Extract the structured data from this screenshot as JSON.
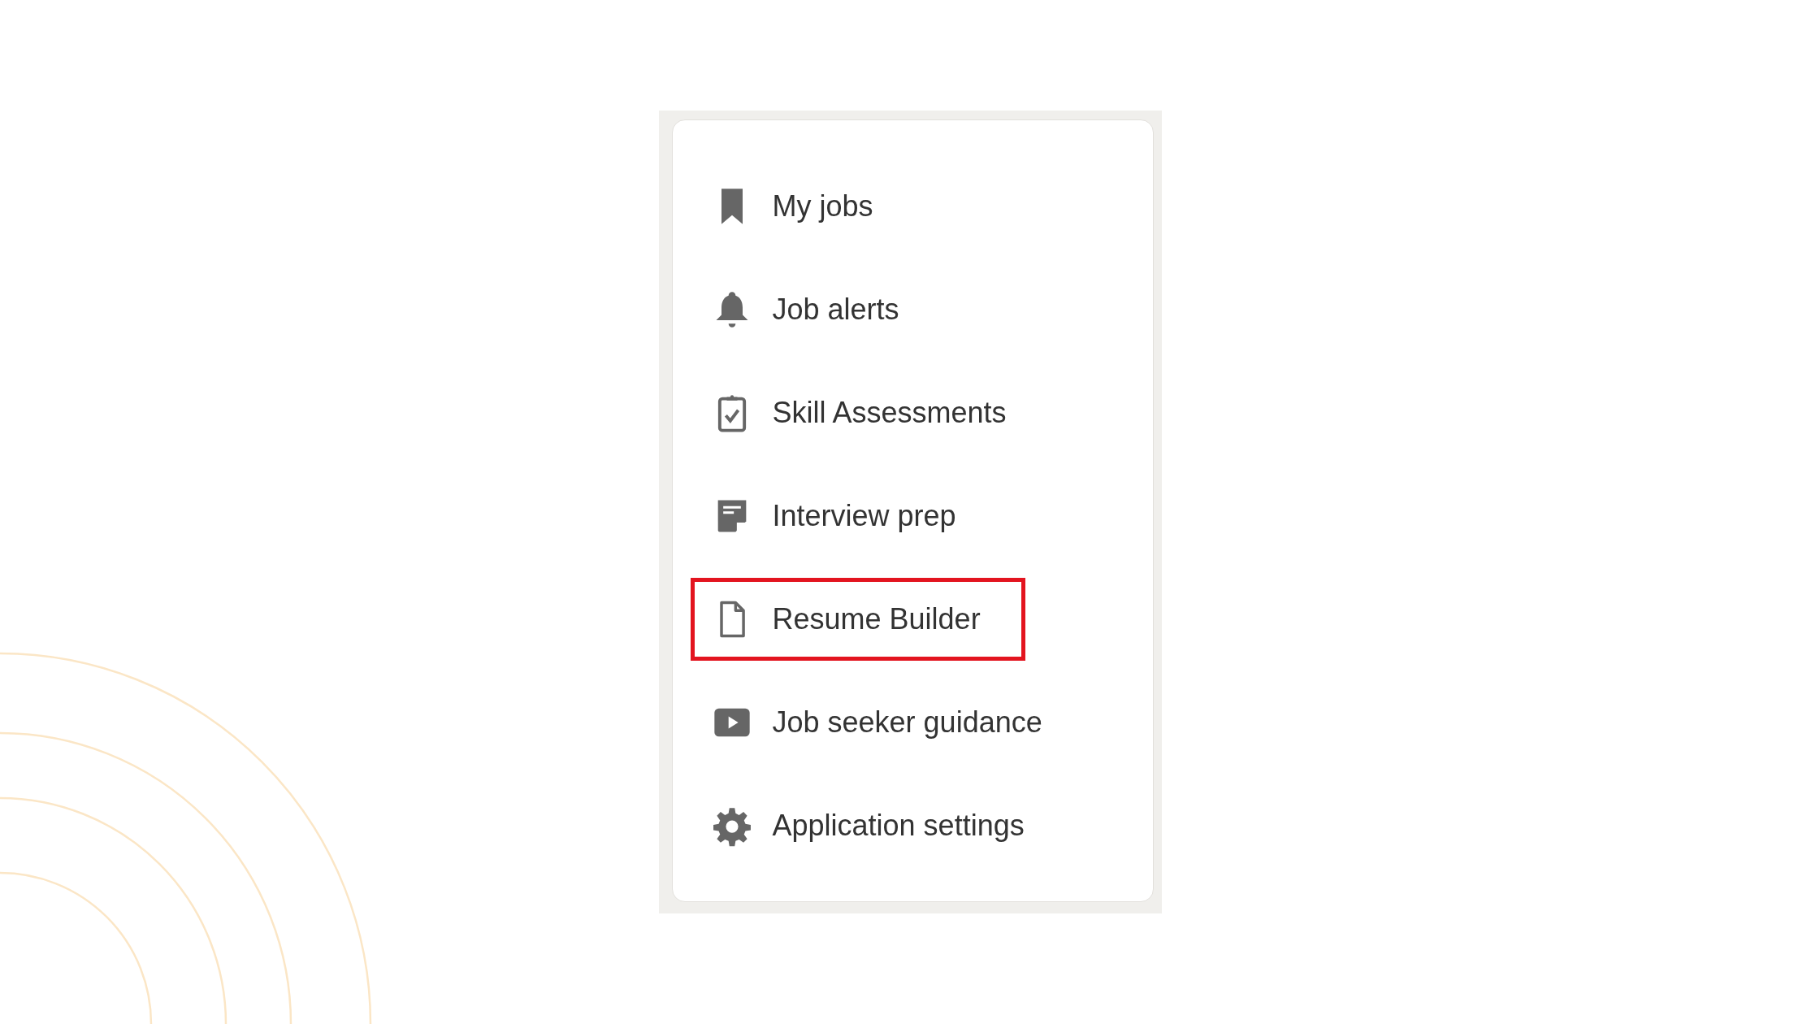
{
  "menu": {
    "items": [
      {
        "label": "My jobs",
        "kind": "bookmark",
        "selected": false
      },
      {
        "label": "Job alerts",
        "kind": "bell",
        "selected": false
      },
      {
        "label": "Skill Assessments",
        "kind": "clipboard",
        "selected": false
      },
      {
        "label": "Interview prep",
        "kind": "note",
        "selected": false
      },
      {
        "label": "Resume Builder",
        "kind": "document",
        "selected": true
      },
      {
        "label": "Job seeker guidance",
        "kind": "play",
        "selected": false
      },
      {
        "label": "Application settings",
        "kind": "gear",
        "selected": false
      }
    ]
  }
}
